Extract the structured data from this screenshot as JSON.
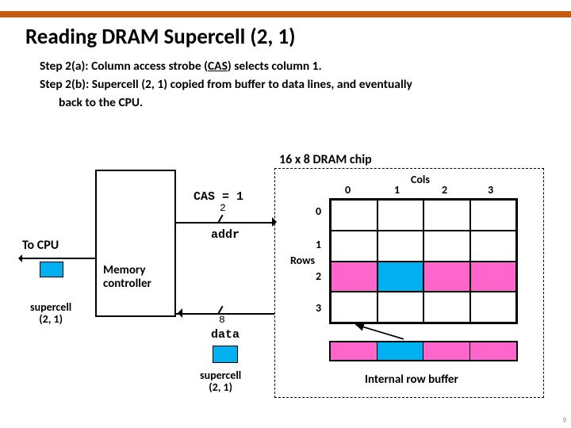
{
  "title": "Reading DRAM Supercell (2, 1)",
  "bullets": {
    "line1_pre": "Step 2(a): Column access strobe (",
    "line1_cas": "CAS",
    "line1_post": ") selects column 1.",
    "line2a": "Step 2(b):  Supercell (2, 1) copied from buffer to data lines, and eventually",
    "line2b": "back to the CPU."
  },
  "chip_label": "16 x 8 DRAM chip",
  "cols_label": "Cols",
  "rows_label": "Rows",
  "col_nums": [
    "0",
    "1",
    "2",
    "3"
  ],
  "row_nums": [
    "0",
    "1",
    "2",
    "3"
  ],
  "rowbuf_label": "Internal row buffer",
  "to_cpu": "To CPU",
  "memctrl": "Memory\ncontroller",
  "cas": "CAS = 1",
  "addr_bus_width": "2",
  "data_bus_width": "8",
  "addr_word": "addr",
  "data_word": "data",
  "supercell_left": "supercell\n(2, 1)",
  "supercell_bot": "supercell\n(2, 1)",
  "page_num": "9",
  "chart_data": {
    "type": "table",
    "title": "DRAM supercell read (2,1) — step 2",
    "grid_rows": 4,
    "grid_cols": 4,
    "active_row": 2,
    "selected_col": 1,
    "selected_cell": [
      2,
      1
    ],
    "row_buffer_source_row": 2,
    "bus_addr_bits": 2,
    "bus_data_bits": 8,
    "signal": "CAS",
    "signal_value": 1
  }
}
